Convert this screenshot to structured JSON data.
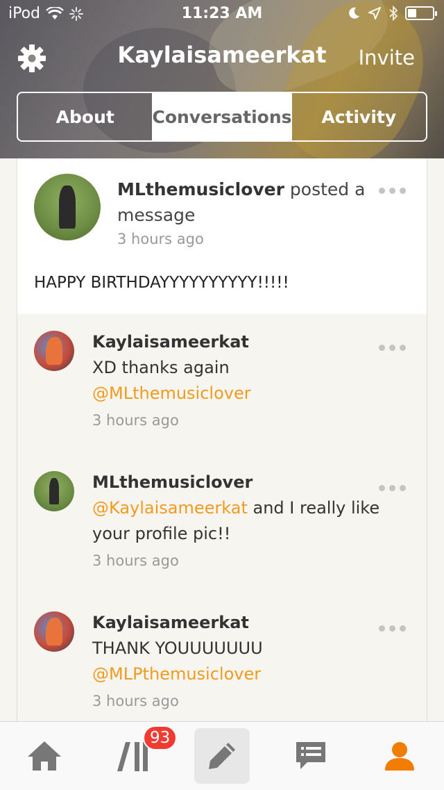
{
  "status_bar": {
    "carrier": "iPod",
    "time": "11:23 AM",
    "battery_level": 0.35
  },
  "header": {
    "title": "Kaylaisameerkat",
    "invite_label": "Invite",
    "tabs": [
      {
        "label": "About",
        "active": false
      },
      {
        "label": "Conversations",
        "active": true
      },
      {
        "label": "Activity",
        "active": false
      }
    ]
  },
  "post": {
    "username": "MLthemusiclover",
    "action": " posted a message",
    "time": "3 hours ago",
    "body": "HAPPY BIRTHDAYYYYYYYYYY!!!!!"
  },
  "comments": [
    {
      "username": "Kaylaisameerkat",
      "text_before": "XD thanks again",
      "mention": "@MLthemusiclover",
      "text_after": "",
      "time": "3 hours ago"
    },
    {
      "username": "MLthemusiclover",
      "text_before": "",
      "mention": "@Kaylaisameerkat",
      "text_after": " and I really like your profile pic!!",
      "time": "3 hours ago"
    },
    {
      "username": "Kaylaisameerkat",
      "text_before": "THANK YOUUUUUUU",
      "mention": "@MLPthemusiclover",
      "text_after": "",
      "time": "3 hours ago"
    }
  ],
  "tab_bar": {
    "badge_count": "93",
    "items": [
      "home-icon",
      "library-icon",
      "compose-icon",
      "chat-icon",
      "profile-icon"
    ]
  },
  "colors": {
    "accent": "#f39a1e",
    "active_tab": "#f07d00",
    "badge": "#f13b32",
    "inactive_icon": "#777777"
  }
}
